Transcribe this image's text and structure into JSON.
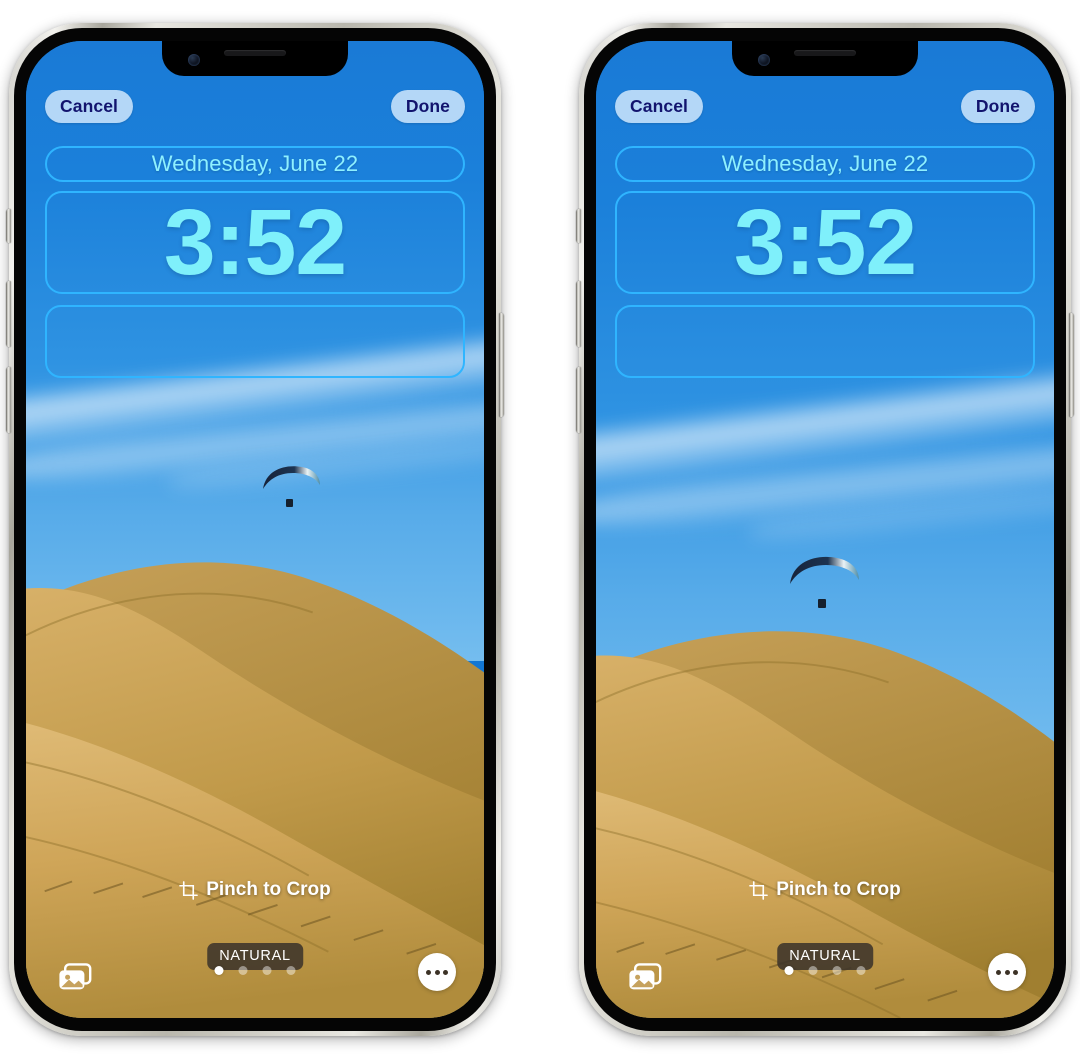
{
  "screen_title": "iPhone Lock Screen Wallpaper Editor",
  "colors": {
    "pill_bg": "#b4d7f7",
    "pill_text": "#12146e",
    "slot_outline": "#2fb5ff",
    "date_text": "#8ef0ff",
    "time_text": "#7ff0fb",
    "badge_bg": "#3a322a",
    "badge_text": "#ffffff",
    "sky_top": "#1a7ad6",
    "sky_bottom": "#74bdef",
    "hill_light": "#d6ae63",
    "hill_dark": "#a9822f"
  },
  "phones": [
    {
      "id": "phone-left",
      "toolbar": {
        "cancel_label": "Cancel",
        "done_label": "Done"
      },
      "lockscreen": {
        "date": "Wednesday, June 22",
        "time": "3:52",
        "widget_slot_empty": true
      },
      "controls": {
        "pinch_label": "Pinch to Crop",
        "crop_icon": "crop-icon",
        "style_badge": "NATURAL",
        "photos_icon": "photos-stack-icon",
        "more_icon": "ellipsis-icon",
        "page_count": 4,
        "page_active_index": 0
      }
    },
    {
      "id": "phone-right",
      "toolbar": {
        "cancel_label": "Cancel",
        "done_label": "Done"
      },
      "lockscreen": {
        "date": "Wednesday, June 22",
        "time": "3:52",
        "widget_slot_empty": true
      },
      "controls": {
        "pinch_label": "Pinch to Crop",
        "crop_icon": "crop-icon",
        "style_badge": "NATURAL",
        "photos_icon": "photos-stack-icon",
        "more_icon": "ellipsis-icon",
        "page_count": 4,
        "page_active_index": 0
      }
    }
  ]
}
